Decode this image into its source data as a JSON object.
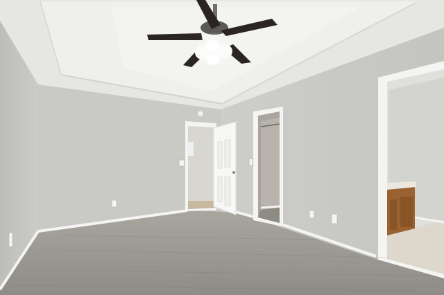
{
  "scene": {
    "kind": "photo",
    "subject": "empty-bedroom-interior",
    "colors": {
      "wall": "#c8c8c4",
      "wall_shadow": "#b9b9b5",
      "ceiling": "#e9e9e6",
      "ceiling_tray": "#f2f2f0",
      "carpet": "#9c9892",
      "baseboard": "#f4f4f2",
      "door": "#f7f7f5",
      "fan_blade": "#2b2522",
      "cabinet": "#9a6230",
      "bath_floor": "#ddd7cc"
    },
    "elements": {
      "ceiling_fan": "ceiling-fan-with-light",
      "doors": [
        "hallway-door-open",
        "closet-doorway",
        "bathroom-doorway"
      ],
      "outlets": 5,
      "light_switches": 2
    }
  }
}
